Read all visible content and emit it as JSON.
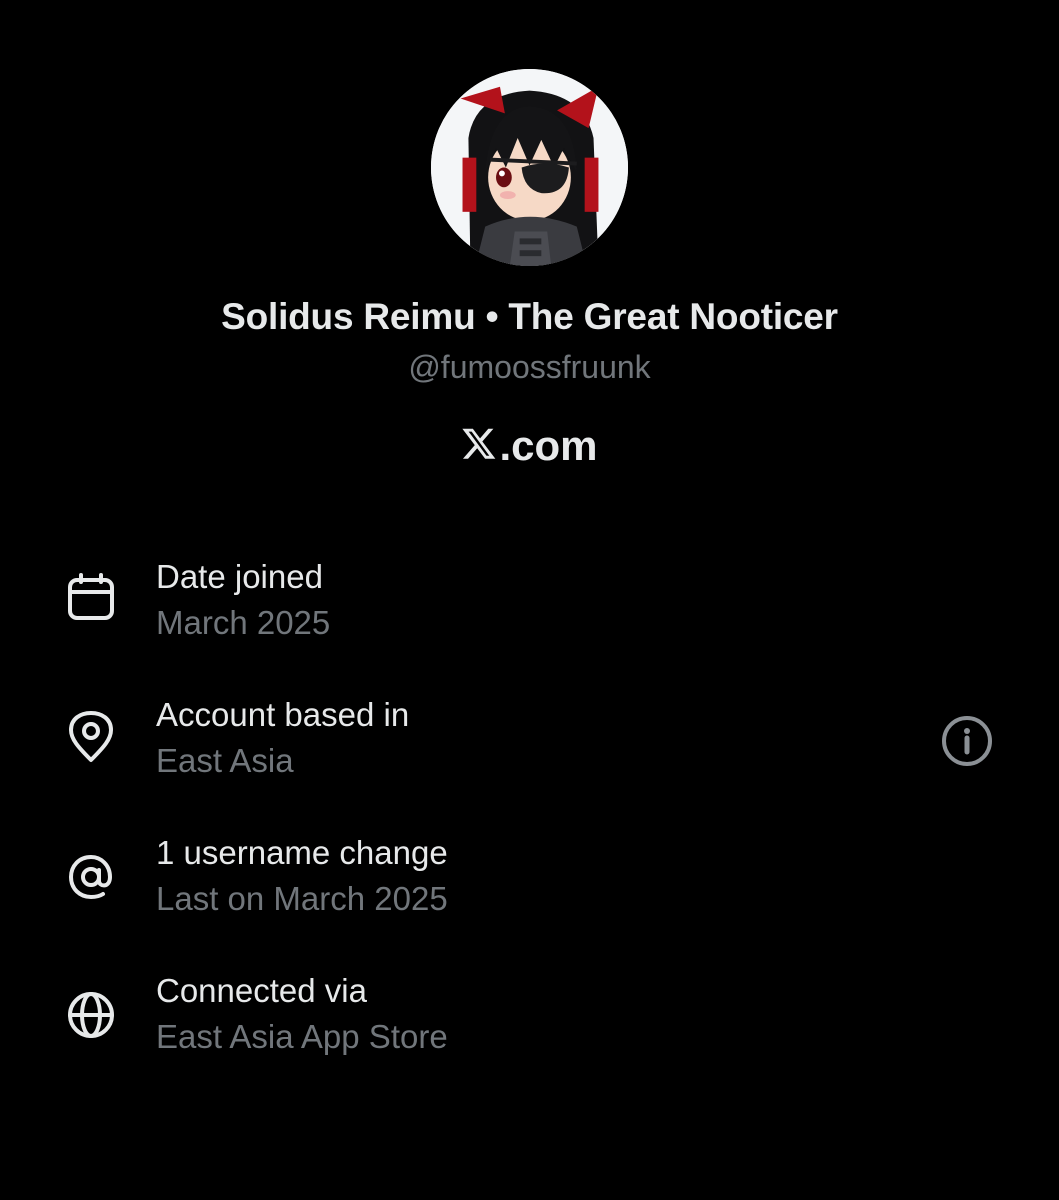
{
  "profile": {
    "display_name": "Solidus Reimu • The Great Nooticer",
    "handle": "@fumoossfruunk",
    "avatar_icon": "anime-avatar"
  },
  "brand": {
    "logo_icon": "x-logo-icon",
    "domain_text": ".com"
  },
  "info_rows": [
    {
      "icon": "calendar-icon",
      "title": "Date joined",
      "value": "March 2025"
    },
    {
      "icon": "location-pin-icon",
      "title": "Account based in",
      "value": "East Asia"
    },
    {
      "icon": "at-sign-icon",
      "title": "1 username change",
      "value": "Last on March 2025"
    },
    {
      "icon": "globe-icon",
      "title": "Connected via",
      "value": "East Asia App Store"
    }
  ],
  "colors": {
    "background": "#000000",
    "primary_text": "#e7e9ea",
    "secondary_text": "#71767b",
    "info_icon": "#8b9095"
  }
}
